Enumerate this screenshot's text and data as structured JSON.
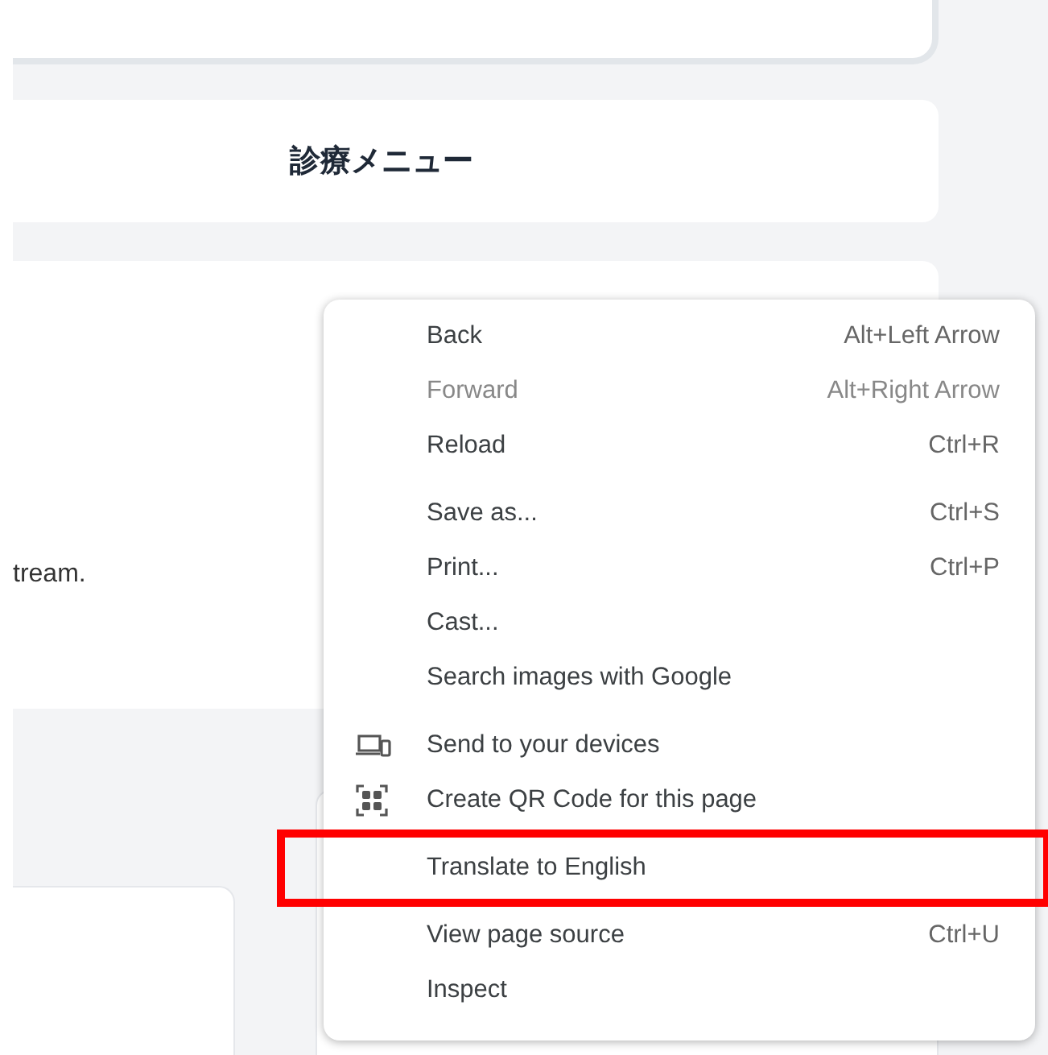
{
  "page": {
    "heading": "診療メニュー",
    "body_text": "tream."
  },
  "context_menu": {
    "groups": [
      [
        {
          "label": "Back",
          "shortcut": "Alt+Left Arrow",
          "kind": "plain",
          "disabled": false,
          "highlighted": false
        },
        {
          "label": "Forward",
          "shortcut": "Alt+Right Arrow",
          "kind": "plain",
          "disabled": true,
          "highlighted": false
        },
        {
          "label": "Reload",
          "shortcut": "Ctrl+R",
          "kind": "plain",
          "disabled": false,
          "highlighted": false
        }
      ],
      [
        {
          "label": "Save as...",
          "shortcut": "Ctrl+S",
          "kind": "plain",
          "disabled": false,
          "highlighted": false
        },
        {
          "label": "Print...",
          "shortcut": "Ctrl+P",
          "kind": "plain",
          "disabled": false,
          "highlighted": false
        },
        {
          "label": "Cast...",
          "kind": "plain",
          "disabled": false,
          "highlighted": false
        },
        {
          "label": "Search images with Google",
          "kind": "plain",
          "disabled": false,
          "highlighted": false
        }
      ],
      [
        {
          "label": "Send to your devices",
          "kind": "devices",
          "disabled": false,
          "highlighted": false
        },
        {
          "label": "Create QR Code for this page",
          "kind": "qr",
          "disabled": false,
          "highlighted": false
        }
      ],
      [
        {
          "label": "Translate to English",
          "kind": "plain",
          "disabled": false,
          "highlighted": true
        }
      ],
      [
        {
          "label": "View page source",
          "shortcut": "Ctrl+U",
          "kind": "plain",
          "disabled": false,
          "highlighted": false
        },
        {
          "label": "Inspect",
          "kind": "plain",
          "disabled": false,
          "highlighted": false
        }
      ]
    ]
  }
}
